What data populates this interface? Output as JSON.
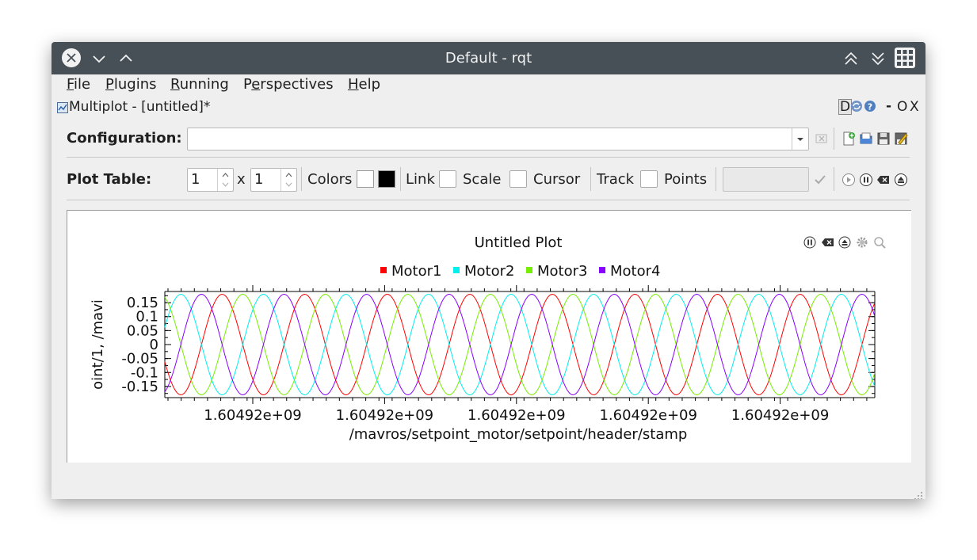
{
  "window": {
    "title": "Default - rqt",
    "minimize_icon": "chevron-down-icon",
    "maximize_icon": "chevron-up-icon",
    "close_icon": "close-icon"
  },
  "menubar": {
    "items": [
      {
        "mnemonic": "F",
        "rest": "ile"
      },
      {
        "mnemonic": "P",
        "rest": "lugins"
      },
      {
        "mnemonic": "R",
        "rest": "unning"
      },
      {
        "pre": "P",
        "mnemonic": "e",
        "rest": "rspectives"
      },
      {
        "mnemonic": "H",
        "rest": "elp"
      }
    ]
  },
  "dock": {
    "title": "Multiplot - [untitled]*",
    "right_controls": {
      "d": "D",
      "minimize": "-",
      "float": "O",
      "close": "X"
    }
  },
  "config": {
    "label": "Configuration:",
    "value": ""
  },
  "plot_table": {
    "label": "Plot Table:",
    "rows": "1",
    "x": "x",
    "cols": "1",
    "colors_label": "Colors",
    "link_label": "Link",
    "scale_label": "Scale",
    "cursor_label": "Cursor",
    "track_label": "Track",
    "points_label": "Points",
    "colors": {
      "white": "#ffffff",
      "black": "#000000"
    }
  },
  "plot": {
    "title": "Untitled Plot",
    "x_axis_label": "/mavros/setpoint_motor/setpoint/header/stamp",
    "y_axis_label": "oint/1, /mavi",
    "legend": [
      {
        "name": "Motor1",
        "color": "#ff0000"
      },
      {
        "name": "Motor2",
        "color": "#00eeee"
      },
      {
        "name": "Motor3",
        "color": "#77ee00"
      },
      {
        "name": "Motor4",
        "color": "#8800ff"
      }
    ]
  },
  "chart_data": {
    "type": "line",
    "title": "Untitled Plot",
    "xlabel": "/mavros/setpoint_motor/setpoint/header/stamp",
    "ylabel": "oint/1, /mavi",
    "ylim": [
      -0.19,
      0.19
    ],
    "y_ticks": [
      "0.15",
      "0.1",
      "0.05",
      "0",
      "-0.05",
      "-0.1",
      "-0.15"
    ],
    "x_ticks": [
      "1.60492e+09",
      "1.60492e+09",
      "1.60492e+09",
      "1.60492e+09",
      "1.60492e+09"
    ],
    "period_cycles": 8.6,
    "amplitude": 0.18,
    "legend_position": "top",
    "grid": false,
    "series": [
      {
        "name": "Motor1",
        "color": "#ff0000",
        "phase_deg": 200
      },
      {
        "name": "Motor2",
        "color": "#00eeee",
        "phase_deg": 20
      },
      {
        "name": "Motor3",
        "color": "#77ee00",
        "phase_deg": 110
      },
      {
        "name": "Motor4",
        "color": "#8800ff",
        "phase_deg": 290
      }
    ]
  }
}
